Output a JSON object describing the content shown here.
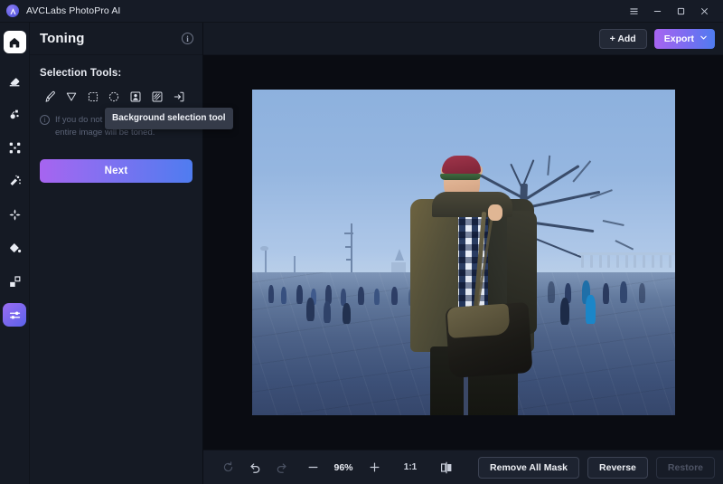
{
  "window": {
    "app_title": "AVCLabs PhotoPro AI",
    "logo_icon": "avclabs-logo-icon",
    "controls": [
      {
        "name": "menu-button",
        "icon": "hamburger-menu-icon"
      },
      {
        "name": "minimize-button",
        "icon": "minimize-icon"
      },
      {
        "name": "maximize-button",
        "icon": "maximize-icon"
      },
      {
        "name": "close-button",
        "icon": "close-icon"
      }
    ]
  },
  "rail": {
    "home_icon": "home-icon",
    "items": [
      {
        "name": "rail-item-erase",
        "icon": "eraser-icon",
        "active": false
      },
      {
        "name": "rail-item-retouch",
        "icon": "retouch-icon",
        "active": false
      },
      {
        "name": "rail-item-enlarge",
        "icon": "expand-arrows-icon",
        "active": false
      },
      {
        "name": "rail-item-magic-brush",
        "icon": "magic-wand-icon",
        "active": false
      },
      {
        "name": "rail-item-enhance",
        "icon": "sparkle-icon",
        "active": false
      },
      {
        "name": "rail-item-colorize",
        "icon": "paint-bucket-icon",
        "active": false
      },
      {
        "name": "rail-item-background",
        "icon": "layers-icon",
        "active": false
      },
      {
        "name": "rail-item-toning",
        "icon": "sliders-icon",
        "active": true
      }
    ]
  },
  "panel": {
    "title": "Toning",
    "info_icon": "info-icon",
    "section_label": "Selection Tools:",
    "tools": [
      {
        "name": "tool-brush",
        "icon": "brush-icon"
      },
      {
        "name": "tool-lasso",
        "icon": "lasso-pointer-icon"
      },
      {
        "name": "tool-rectangle-select",
        "icon": "rectangle-marquee-icon"
      },
      {
        "name": "tool-ellipse-select",
        "icon": "ellipse-marquee-icon"
      },
      {
        "name": "tool-portrait-selection",
        "icon": "portrait-selection-icon"
      },
      {
        "name": "tool-sky-selection",
        "icon": "sky-selection-icon"
      },
      {
        "name": "tool-background-selection",
        "icon": "background-selection-icon"
      }
    ],
    "hint_icon": "info-icon",
    "hint_text": "If you do not make a selection, the entire image will be toned.",
    "tooltip": "Background selection tool",
    "next_label": "Next"
  },
  "topbar": {
    "add_label": "+ Add",
    "add_icon": "plus-icon",
    "export_label": "Export",
    "export_caret_icon": "chevron-down-icon"
  },
  "canvas": {
    "photo_alt": "young-man-in-plaid-shirt-and-cap-standing-on-city-plaza",
    "photo_scene": {
      "subject": "man wearing red cap with green brim, olive jacket, blue and white plaid shirt, black shoulder bag",
      "background": "blue-toned city plaza with bare tree, distant church domes, crowd of pedestrians, stone balustrade"
    }
  },
  "bottombar": {
    "controls": [
      {
        "name": "reset-button",
        "icon": "refresh-icon",
        "disabled": true
      },
      {
        "name": "undo-button",
        "icon": "undo-icon",
        "disabled": false
      },
      {
        "name": "redo-button",
        "icon": "redo-icon",
        "disabled": true
      }
    ],
    "zoom_out_icon": "minus-icon",
    "zoom_level": "96%",
    "zoom_in_icon": "plus-icon",
    "actual_size_label": "1:1",
    "compare_icon": "compare-split-icon",
    "actions": [
      {
        "name": "remove-all-mask-button",
        "label": "Remove All Mask",
        "disabled": false
      },
      {
        "name": "reverse-button",
        "label": "Reverse",
        "disabled": false
      },
      {
        "name": "restore-button",
        "label": "Restore",
        "disabled": true
      }
    ]
  },
  "colors": {
    "accent_purple": "#a764f0",
    "accent_blue": "#4f7cf0",
    "panel_bg": "#151a24",
    "canvas_bg": "#0a0c12",
    "titlebar_bg": "#161b26",
    "bottombar_bg": "#171c27",
    "text_primary": "#eef0f5",
    "text_muted": "#5b6377",
    "tooltip_bg": "#353b49"
  }
}
